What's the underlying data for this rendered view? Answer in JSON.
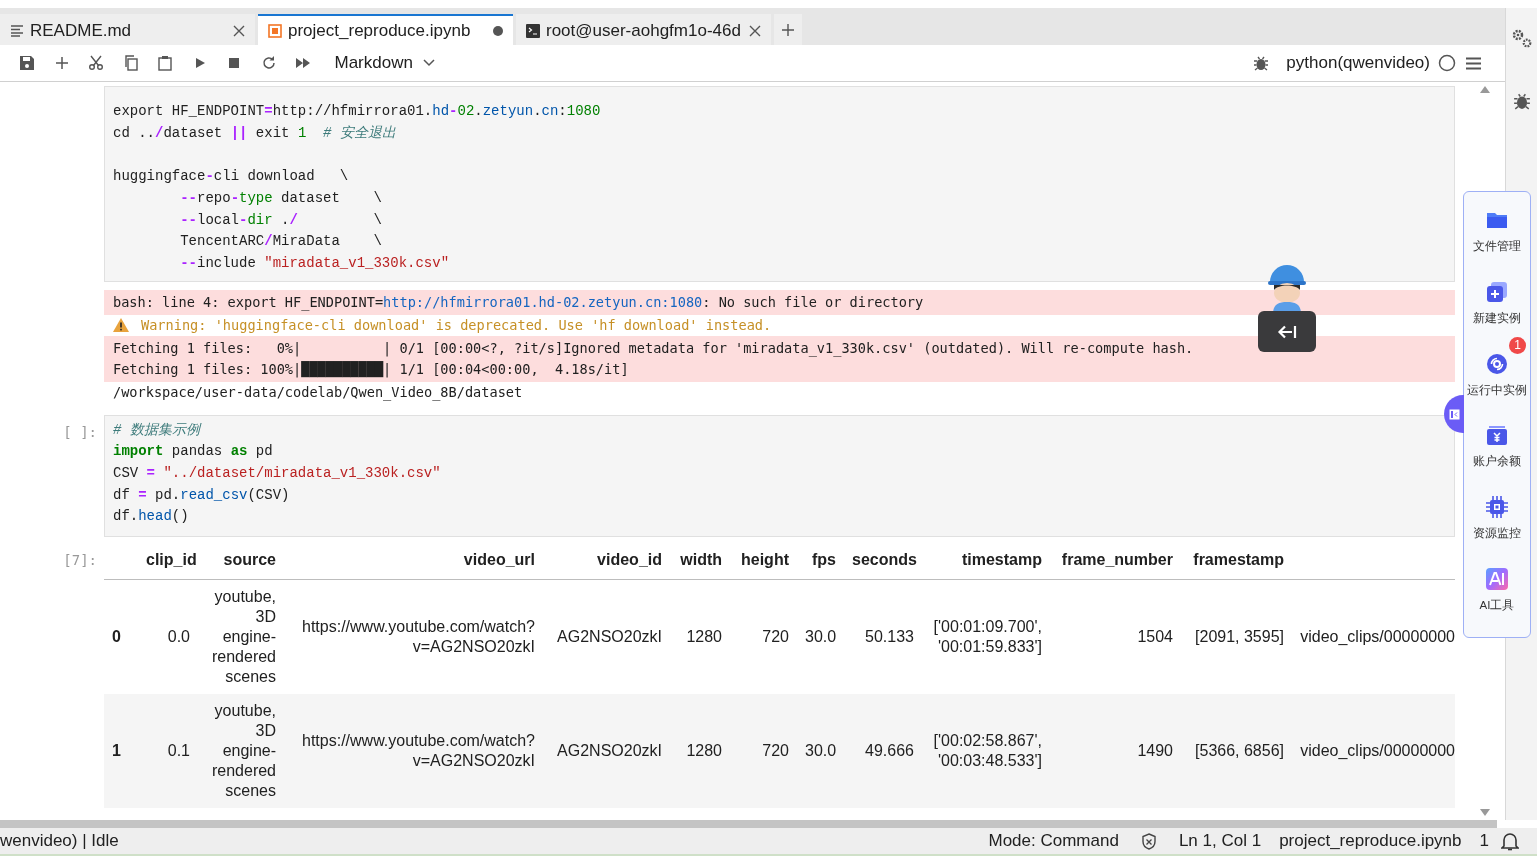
{
  "tabs": [
    {
      "label": "README.md",
      "kind": "markdown",
      "selected": false,
      "dirty": false
    },
    {
      "label": "project_reproduce.ipynb",
      "kind": "notebook",
      "selected": true,
      "dirty": true
    },
    {
      "label": "root@user-aohgfm1o-46d",
      "kind": "terminal",
      "selected": false,
      "dirty": false
    }
  ],
  "toolbar": {
    "cell_type": "Markdown",
    "kernel": {
      "name": "python(qwenvideo)",
      "busy": false
    }
  },
  "cells": [
    {
      "code": [
        {
          "tokens": [
            {
              "text": "export HF_ENDPOINT",
              "kind": "plain"
            },
            {
              "text": "=",
              "kind": "op"
            },
            {
              "text": "http://hfmirrora01.",
              "kind": "plain"
            },
            {
              "text": "hd",
              "kind": "attr"
            },
            {
              "text": "-",
              "kind": "op"
            },
            {
              "text": "02",
              "kind": "num"
            },
            {
              "text": ".",
              "kind": "plain"
            },
            {
              "text": "zetyun",
              "kind": "attr"
            },
            {
              "text": ".",
              "kind": "plain"
            },
            {
              "text": "cn",
              "kind": "attr"
            },
            {
              "text": ":",
              "kind": "plain"
            },
            {
              "text": "1080",
              "kind": "num"
            }
          ]
        },
        {
          "tokens": [
            {
              "text": "cd ..",
              "kind": "plain"
            },
            {
              "text": "/",
              "kind": "op"
            },
            {
              "text": "dataset ",
              "kind": "plain"
            },
            {
              "text": "||",
              "kind": "op"
            },
            {
              "text": " exit ",
              "kind": "plain"
            },
            {
              "text": "1  ",
              "kind": "num"
            },
            {
              "text": "# 安全退出",
              "kind": "comment"
            }
          ]
        },
        {
          "kind": "blank"
        },
        {
          "tokens": [
            {
              "text": "huggingface",
              "kind": "plain"
            },
            {
              "text": "-",
              "kind": "op"
            },
            {
              "text": "cli download   \\",
              "kind": "plain"
            }
          ]
        },
        {
          "tokens": [
            {
              "text": "        --",
              "kind": "op"
            },
            {
              "text": "repo",
              "kind": "plain"
            },
            {
              "text": "-",
              "kind": "op"
            },
            {
              "text": "type",
              "kind": "num"
            },
            {
              "text": " dataset    \\",
              "kind": "plain"
            }
          ]
        },
        {
          "tokens": [
            {
              "text": "        --",
              "kind": "op"
            },
            {
              "text": "local",
              "kind": "plain"
            },
            {
              "text": "-",
              "kind": "op"
            },
            {
              "text": "dir",
              "kind": "num"
            },
            {
              "text": " .",
              "kind": "plain"
            },
            {
              "text": "/",
              "kind": "op"
            },
            {
              "text": "         \\",
              "kind": "plain"
            }
          ]
        },
        {
          "tokens": [
            {
              "text": "        TencentARC",
              "kind": "plain"
            },
            {
              "text": "/",
              "kind": "op"
            },
            {
              "text": "MiraData    \\",
              "kind": "plain"
            }
          ]
        },
        {
          "tokens": [
            {
              "text": "        --",
              "kind": "op"
            },
            {
              "text": "include ",
              "kind": "plain"
            },
            {
              "text": "\"miradata_v1_330k.csv\"",
              "kind": "str"
            }
          ]
        }
      ],
      "outputs": [
        {
          "kind": "stderr",
          "lines": [
            {
              "tokens": [
                {
                  "text": "bash: line 4: export HF_ENDPOINT=",
                  "kind": "plain"
                },
                {
                  "text": "http://hfmirrora01.hd-02.zetyun.cn:1080",
                  "kind": "link"
                },
                {
                  "text": ": No such file or directory",
                  "kind": "plain"
                }
              ]
            }
          ]
        },
        {
          "kind": "warning",
          "lines": [
            {
              "tokens": [
                {
                  "text": "Warning: 'huggingface-cli download' is deprecated. Use 'hf download' instead.",
                  "kind": "plain"
                }
              ]
            }
          ]
        },
        {
          "kind": "stderr",
          "lines": [
            {
              "tokens": [
                {
                  "text": "Fetching 1 files:   0%|          | 0/1 [00:00<?, ?it/s]Ignored metadata for 'miradata_v1_330k.csv' (outdated). Will re-compute hash.",
                  "kind": "plain"
                }
              ]
            },
            {
              "tokens": [
                {
                  "text": "Fetching 1 files: 100%|██████████| 1/1 [00:04<00:00,  4.18s/it]",
                  "kind": "plain"
                }
              ]
            }
          ]
        },
        {
          "kind": "stdout",
          "lines": [
            {
              "tokens": [
                {
                  "text": "/workspace/user-data/codelab/Qwen_Video_8B/dataset",
                  "kind": "plain"
                }
              ]
            }
          ]
        }
      ]
    },
    {
      "prompt": "[ ]:",
      "code": [
        {
          "tokens": [
            {
              "text": "# 数据集示例",
              "kind": "comment"
            }
          ]
        },
        {
          "tokens": [
            {
              "text": "import",
              "kind": "kw"
            },
            {
              "text": " pandas ",
              "kind": "plain"
            },
            {
              "text": "as",
              "kind": "kw"
            },
            {
              "text": " pd",
              "kind": "plain"
            }
          ]
        },
        {
          "tokens": [
            {
              "text": "CSV ",
              "kind": "plain"
            },
            {
              "text": "= ",
              "kind": "op"
            },
            {
              "text": "\"../dataset/miradata_v1_330k.csv\"",
              "kind": "str"
            }
          ]
        },
        {
          "tokens": [
            {
              "text": "df ",
              "kind": "plain"
            },
            {
              "text": "=",
              "kind": "op"
            },
            {
              "text": " pd.",
              "kind": "plain"
            },
            {
              "text": "read_csv",
              "kind": "attr"
            },
            {
              "text": "(CSV)",
              "kind": "plain"
            }
          ]
        },
        {
          "tokens": [
            {
              "text": "df.",
              "kind": "plain"
            },
            {
              "text": "head",
              "kind": "attr"
            },
            {
              "text": "()",
              "kind": "plain"
            }
          ]
        }
      ],
      "output_prompt": "[7]:",
      "table": {
        "columns": [
          "clip_id",
          "source",
          "video_url",
          "video_id",
          "width",
          "height",
          "fps",
          "seconds",
          "timestamp",
          "frame_number",
          "framestamp"
        ],
        "rows": [
          {
            "index": "0",
            "cells": [
              "0.0",
              "youtube, 3D engine-rendered scenes",
              "https://www.youtube.com/watch?v=AG2NSO20zkI",
              "AG2NSO20zkI",
              "1280",
              "720",
              "30.0",
              "50.133",
              "['00:01:09.700', '00:01:59.833']",
              "1504",
              "[2091, 3595]",
              "video_clips/00000000"
            ]
          },
          {
            "index": "1",
            "cells": [
              "0.1",
              "youtube, 3D engine-rendered scenes",
              "https://www.youtube.com/watch?v=AG2NSO20zkI",
              "AG2NSO20zkI",
              "1280",
              "720",
              "30.0",
              "49.666",
              "['00:02:58.867', '00:03:48.533']",
              "1490",
              "[5366, 6856]",
              "video_clips/00000000"
            ]
          }
        ]
      }
    }
  ],
  "sidebar": {
    "items": [
      {
        "label": "文件管理"
      },
      {
        "label": "新建实例"
      },
      {
        "label": "运行中实例",
        "badge": "1"
      },
      {
        "label": "账户余额"
      },
      {
        "label": "资源监控"
      },
      {
        "label": "AI工具"
      }
    ]
  },
  "status_bar": {
    "kernel": "wenvideo) | Idle",
    "mode": "Mode: Command",
    "cursor": "Ln 1, Col 1",
    "file": "project_reproduce.ipynb",
    "notifications": "1"
  }
}
